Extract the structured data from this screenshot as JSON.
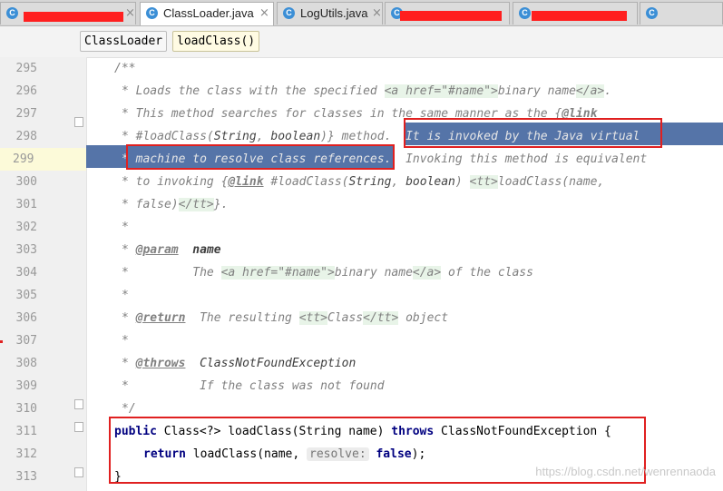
{
  "tabs": [
    {
      "label": "",
      "icon": "C",
      "redacted": true
    },
    {
      "label": "ClassLoader.java",
      "icon": "C",
      "active": true
    },
    {
      "label": "LogUtils.java",
      "icon": "C"
    },
    {
      "label": "",
      "icon": "C",
      "redacted": true
    },
    {
      "label": "",
      "icon": "C",
      "redacted": true
    },
    {
      "label": "",
      "icon": "C"
    }
  ],
  "close_glyph": "×",
  "breadcrumb": [
    "ClassLoader",
    "loadClass()"
  ],
  "line_numbers": [
    "295",
    "296",
    "297",
    "298",
    "299",
    "300",
    "301",
    "302",
    "303",
    "304",
    "305",
    "306",
    "307",
    "308",
    "309",
    "310",
    "311",
    "312",
    "313"
  ],
  "code": {
    "l295": "/**",
    "l296a": "* Loads the class with the specified ",
    "l296b": "<a href=\"#name\">",
    "l296c": "binary name",
    "l296d": "</a>",
    "l296e": ".",
    "l297a": "* This method searches for classes in the same manner as the {",
    "l297b": "@link",
    "l298a": "* #loadClass(",
    "l298b": "String",
    "l298c": ", ",
    "l298d": "boolean",
    "l298e": ")} method.  ",
    "l298f": "It is invoked by the Java virtual",
    "l299a": "* machine to resolve class references.",
    "l299b": "  Invoking this method is equivalent",
    "l300a": "* to invoking {",
    "l300b": "@link",
    "l300c": " #loadClass(",
    "l300d": "String",
    "l300e": ", ",
    "l300f": "boolean",
    "l300g": ") ",
    "l300h": "<tt>",
    "l300i": "loadClass(name,",
    "l301a": "* false)",
    "l301b": "</tt>",
    "l301c": "}.",
    "l302": "*",
    "l303a": "* ",
    "l303b": "@param",
    "l303c": "  name",
    "l304a": "*         The ",
    "l304b": "<a href=\"#name\">",
    "l304c": "binary name",
    "l304d": "</a>",
    "l304e": " of the class",
    "l305": "*",
    "l306a": "* ",
    "l306b": "@return",
    "l306c": "  The resulting ",
    "l306d": "<tt>",
    "l306e": "Class",
    "l306f": "</tt>",
    "l306g": " object",
    "l307": "*",
    "l308a": "* ",
    "l308b": "@throws",
    "l308c": "  ClassNotFoundException",
    "l309": "*          If the class was not found",
    "l310": "*/",
    "l311a": "public",
    "l311b": " Class<?> loadClass(String name) ",
    "l311c": "throws",
    "l311d": " ClassNotFoundException {",
    "l312a": "return",
    "l312b": " loadClass(name, ",
    "l312c": "resolve:",
    "l312d": " false",
    "l312e": ");",
    "l313": "}"
  },
  "watermark": "https://blog.csdn.net/wenrennaoda",
  "colors": {
    "selection": "#5574a8",
    "annotation_box": "#e02020",
    "keyword": "#000080",
    "comment": "#808080"
  }
}
